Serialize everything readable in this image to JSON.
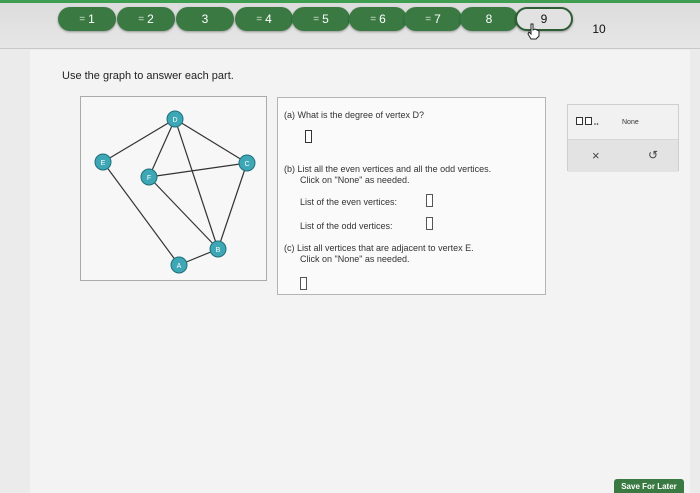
{
  "nav": {
    "questions": [
      {
        "label": "1",
        "status": "answered"
      },
      {
        "label": "2",
        "status": "answered"
      },
      {
        "label": "3",
        "status": "answered"
      },
      {
        "label": "4",
        "status": "answered"
      },
      {
        "label": "5",
        "status": "answered"
      },
      {
        "label": "6",
        "status": "answered"
      },
      {
        "label": "7",
        "status": "answered"
      },
      {
        "label": "8",
        "status": "answered"
      },
      {
        "label": "9",
        "status": "current"
      },
      {
        "label": "10",
        "status": "unanswered"
      }
    ]
  },
  "prompt": "Use the graph to answer each part.",
  "graph": {
    "vertices": [
      {
        "label": "D"
      },
      {
        "label": "E"
      },
      {
        "label": "F"
      },
      {
        "label": "C"
      },
      {
        "label": "B"
      },
      {
        "label": "A"
      }
    ],
    "node_color": "#3da7b5"
  },
  "question": {
    "part_a": {
      "text": "(a) What is the degree of vertex D?",
      "answer": ""
    },
    "part_b": {
      "text": "(b) List all the even vertices and all the odd vertices.",
      "note": "Click on \"None\" as needed.",
      "even_label": "List of the even vertices:",
      "odd_label": "List of the odd vertices:",
      "even_answer": "",
      "odd_answer": ""
    },
    "part_c": {
      "text": "(c) List all vertices that are adjacent to vertex E.",
      "note": "Click on \"None\" as needed.",
      "answer": ""
    }
  },
  "tools": {
    "none_label": "None",
    "clear_glyph": "×",
    "undo_glyph": "↺"
  },
  "footer": {
    "save_label": "Save For Later"
  },
  "colors": {
    "accent": "#3a7a42",
    "top_green": "#3f9d52"
  }
}
